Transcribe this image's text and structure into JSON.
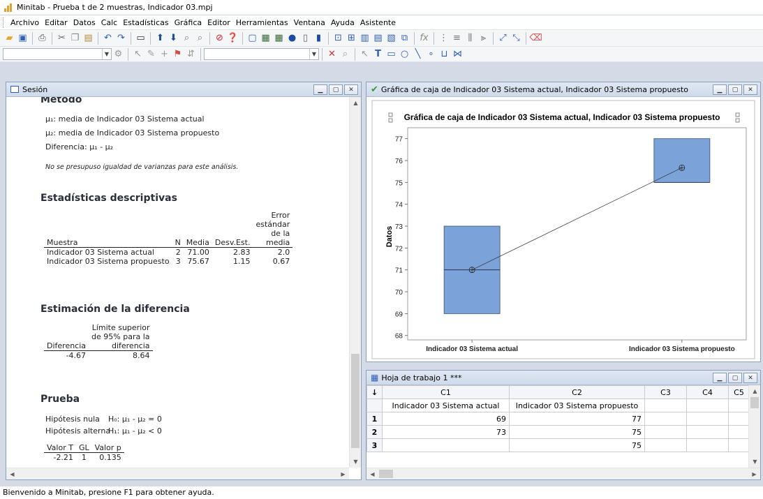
{
  "app": {
    "title": "Minitab - Prueba t de 2 muestras, Indicador 03.mpj",
    "status": "Bienvenido a Minitab, presione F1 para obtener ayuda."
  },
  "menu": [
    "Archivo",
    "Editar",
    "Datos",
    "Calc",
    "Estadísticas",
    "Gráfica",
    "Editor",
    "Herramientas",
    "Ventana",
    "Ayuda",
    "Asistente"
  ],
  "session": {
    "title": "Sesión",
    "method_heading": "Método",
    "mu1": "μ₁: media de Indicador 03 Sistema actual",
    "mu2": "μ₂: media de Indicador 03 Sistema propuesto",
    "diff": "Diferencia: μ₁ - μ₂",
    "note": "No se presupuso igualdad de varianzas para este análisis.",
    "desc_heading": "Estadísticas descriptivas",
    "desc_headers": {
      "sample": "Muestra",
      "n": "N",
      "mean": "Media",
      "sd": "Desv.Est.",
      "se1": "Error",
      "se2": "estándar",
      "se3": "de la",
      "se4": "media"
    },
    "desc_rows": [
      {
        "sample": "Indicador 03 Sistema actual",
        "n": "2",
        "mean": "71.00",
        "sd": "2.83",
        "se": "2.0"
      },
      {
        "sample": "Indicador 03 Sistema propuesto",
        "n": "3",
        "mean": "75.67",
        "sd": "1.15",
        "se": "0.67"
      }
    ],
    "est_heading": "Estimación de la diferencia",
    "est_headers": {
      "diff": "Diferencia",
      "ul1": "Límite superior",
      "ul2": "de 95% para la",
      "ul3": "diferencia"
    },
    "est_row": {
      "diff": "-4.67",
      "ul": "8.64"
    },
    "test_heading": "Prueba",
    "null_label": "Hipótesis nula",
    "null_value": "H₀: μ₁ - μ₂ = 0",
    "alt_label": "Hipótesis alterna",
    "alt_value": "H₁: μ₁ - μ₂ < 0",
    "test_headers": {
      "t": "Valor T",
      "gl": "GL",
      "p": "Valor p"
    },
    "test_row": {
      "t": "-2.21",
      "gl": "1",
      "p": "0.135"
    }
  },
  "graph_window": {
    "title": "Gráfica de caja de Indicador 03 Sistema actual, Indicador 03 Sistema propuesto"
  },
  "chart_data": {
    "type": "box",
    "title": "Gráfica de caja de Indicador 03 Sistema actual, Indicador 03 Sistema propuesto",
    "ylabel": "Datos",
    "xlabel": "",
    "ylim": [
      67.8,
      77.5
    ],
    "yticks": [
      68,
      69,
      70,
      71,
      72,
      73,
      74,
      75,
      76,
      77
    ],
    "categories": [
      "Indicador 03 Sistema actual",
      "Indicador 03 Sistema propuesto"
    ],
    "boxes": [
      {
        "q1": 69,
        "median": 71,
        "q3": 73,
        "mean": 71
      },
      {
        "q1": 75,
        "median": 75,
        "q3": 77,
        "mean": 75.67
      }
    ],
    "box_color": "#7ba3d9",
    "grid": false
  },
  "worksheet": {
    "title": "Hoja de trabajo 1 ***",
    "columns": [
      "C1",
      "C2",
      "C3",
      "C4",
      "C5"
    ],
    "names": [
      "Indicador 03 Sistema actual",
      "Indicador 03 Sistema propuesto",
      "",
      "",
      ""
    ],
    "rows": [
      {
        "n": "1",
        "c1": "69",
        "c2": "77"
      },
      {
        "n": "2",
        "c1": "73",
        "c2": "75"
      },
      {
        "n": "3",
        "c1": "",
        "c2": "75"
      }
    ]
  }
}
